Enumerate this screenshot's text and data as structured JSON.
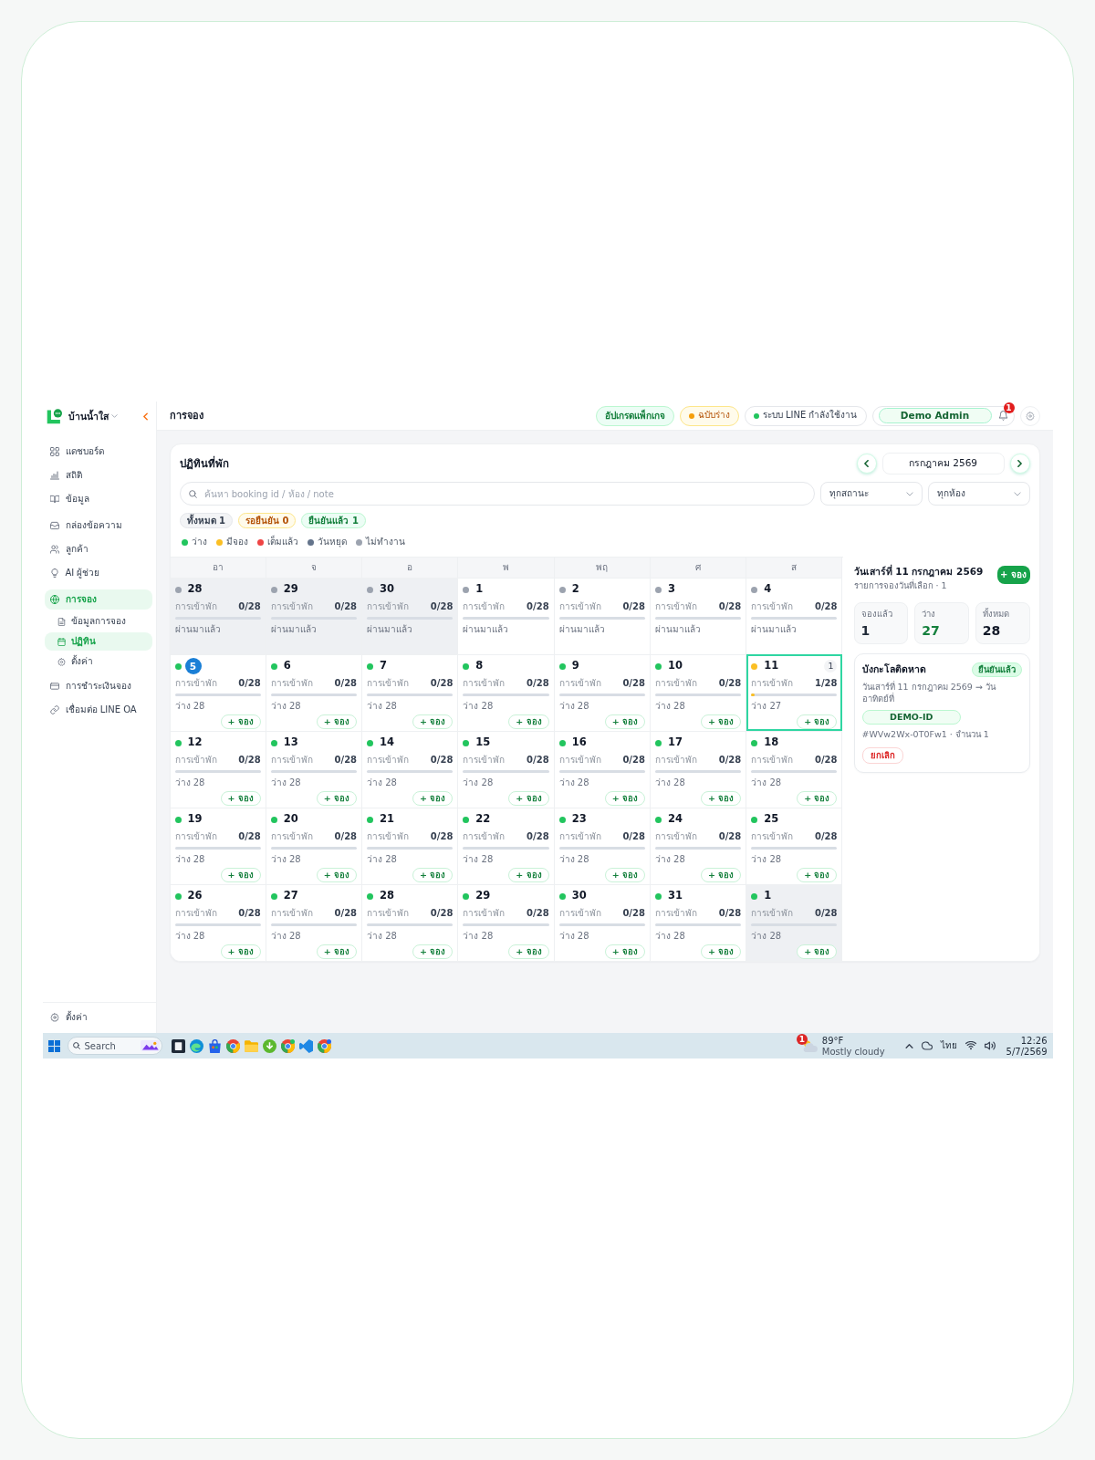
{
  "sidebar": {
    "brand": "บ้านน้ำใส",
    "sections": [
      {
        "items": [
          {
            "label": "แดชบอร์ด",
            "selected": false
          },
          {
            "label": "สถิติ",
            "selected": false
          },
          {
            "label": "ข้อมูล",
            "selected": false
          }
        ]
      },
      {
        "items": [
          {
            "label": "กล่องข้อความ",
            "selected": false
          },
          {
            "label": "ลูกค้า",
            "selected": false
          },
          {
            "label": "AI ผู้ช่วย",
            "selected": false
          }
        ]
      },
      {
        "items": [
          {
            "label": "การจอง",
            "selected": true,
            "children": [
              {
                "label": "ข้อมูลการจอง",
                "selected": false
              },
              {
                "label": "ปฏิทิน",
                "selected": true
              },
              {
                "label": "ตั้งค่า",
                "selected": false
              }
            ]
          }
        ]
      },
      {
        "items": [
          {
            "label": "การชำระเงินจอง",
            "selected": false
          },
          {
            "label": "เชื่อมต่อ LINE OA",
            "selected": false
          }
        ]
      }
    ],
    "footer_items": [
      {
        "label": "ตั้งค่า",
        "selected": false
      }
    ]
  },
  "header": {
    "title": "การจอง",
    "upgrade_button": "อัปเกรดแพ็กเกจ",
    "draft_badge": "ฉบับร่าง",
    "line_status": "ระบบ LINE กำลังใช้งาน",
    "user_name": "Demo Admin",
    "notification_count": "1"
  },
  "calendar": {
    "title": "ปฏิทินที่พัก",
    "month": "กรกฎาคม 2569",
    "search": {
      "placeholder": "ค้นหา booking id / ห้อง / note"
    },
    "filters": [
      {
        "value": "ทุกสถานะ"
      },
      {
        "value": "ทุกห้อง"
      }
    ],
    "chips": [
      {
        "label": "ทั้งหมด 1",
        "kind": "all"
      },
      {
        "label": "รอยืนยัน 0",
        "kind": "pending"
      },
      {
        "label": "ยืนยันแล้ว 1",
        "kind": "confirmed"
      }
    ],
    "legend": [
      {
        "label": "ว่าง",
        "color": "#22c55e"
      },
      {
        "label": "มีจอง",
        "color": "#fbbf24"
      },
      {
        "label": "เต็มแล้ว",
        "color": "#ef4444"
      },
      {
        "label": "วันหยุด",
        "color": "#64748b"
      },
      {
        "label": "ไม่ทำงาน",
        "color": "#9ca3af"
      }
    ],
    "weekdays": [
      "อา",
      "จ",
      "อ",
      "พ",
      "พฤ",
      "ศ",
      "ส"
    ],
    "weeks": [
      [
        {
          "day": "28",
          "color": "#9ca3af",
          "in_month": false,
          "today": false,
          "selected": false,
          "label": "การเข้าพัก",
          "occupancy": "0/28",
          "note": "ผ่านมาแล้ว"
        },
        {
          "day": "29",
          "color": "#9ca3af",
          "in_month": false,
          "today": false,
          "selected": false,
          "label": "การเข้าพัก",
          "occupancy": "0/28",
          "note": "ผ่านมาแล้ว"
        },
        {
          "day": "30",
          "color": "#9ca3af",
          "in_month": false,
          "today": false,
          "selected": false,
          "label": "การเข้าพัก",
          "occupancy": "0/28",
          "note": "ผ่านมาแล้ว"
        },
        {
          "day": "1",
          "color": "#9ca3af",
          "in_month": true,
          "today": false,
          "selected": false,
          "label": "การเข้าพัก",
          "occupancy": "0/28",
          "note": "ผ่านมาแล้ว"
        },
        {
          "day": "2",
          "color": "#9ca3af",
          "in_month": true,
          "today": false,
          "selected": false,
          "label": "การเข้าพัก",
          "occupancy": "0/28",
          "note": "ผ่านมาแล้ว"
        },
        {
          "day": "3",
          "color": "#9ca3af",
          "in_month": true,
          "today": false,
          "selected": false,
          "label": "การเข้าพัก",
          "occupancy": "0/28",
          "note": "ผ่านมาแล้ว"
        },
        {
          "day": "4",
          "color": "#9ca3af",
          "in_month": true,
          "today": false,
          "selected": false,
          "label": "การเข้าพัก",
          "occupancy": "0/28",
          "note": "ผ่านมาแล้ว"
        }
      ],
      [
        {
          "day": "5",
          "color": "#22c55e",
          "in_month": true,
          "today": true,
          "selected": false,
          "label": "การเข้าพัก",
          "occupancy": "0/28",
          "note": "ว่าง 28",
          "book_button": "+ จอง"
        },
        {
          "day": "6",
          "color": "#22c55e",
          "in_month": true,
          "today": false,
          "selected": false,
          "label": "การเข้าพัก",
          "occupancy": "0/28",
          "note": "ว่าง 28",
          "book_button": "+ จอง"
        },
        {
          "day": "7",
          "color": "#22c55e",
          "in_month": true,
          "today": false,
          "selected": false,
          "label": "การเข้าพัก",
          "occupancy": "0/28",
          "note": "ว่าง 28",
          "book_button": "+ จอง"
        },
        {
          "day": "8",
          "color": "#22c55e",
          "in_month": true,
          "today": false,
          "selected": false,
          "label": "การเข้าพัก",
          "occupancy": "0/28",
          "note": "ว่าง 28",
          "book_button": "+ จอง"
        },
        {
          "day": "9",
          "color": "#22c55e",
          "in_month": true,
          "today": false,
          "selected": false,
          "label": "การเข้าพัก",
          "occupancy": "0/28",
          "note": "ว่าง 28",
          "book_button": "+ จอง"
        },
        {
          "day": "10",
          "color": "#22c55e",
          "in_month": true,
          "today": false,
          "selected": false,
          "label": "การเข้าพัก",
          "occupancy": "0/28",
          "note": "ว่าง 28",
          "book_button": "+ จอง"
        },
        {
          "day": "11",
          "color": "#fbbf24",
          "in_month": true,
          "today": false,
          "selected": true,
          "count": "1",
          "label": "การเข้าพัก",
          "occupancy": "1/28",
          "level": 0.036,
          "note": "ว่าง 27",
          "book_button": "+ จอง"
        }
      ],
      [
        {
          "day": "12",
          "color": "#22c55e",
          "in_month": true,
          "today": false,
          "selected": false,
          "label": "การเข้าพัก",
          "occupancy": "0/28",
          "note": "ว่าง 28",
          "book_button": "+ จอง"
        },
        {
          "day": "13",
          "color": "#22c55e",
          "in_month": true,
          "today": false,
          "selected": false,
          "label": "การเข้าพัก",
          "occupancy": "0/28",
          "note": "ว่าง 28",
          "book_button": "+ จอง"
        },
        {
          "day": "14",
          "color": "#22c55e",
          "in_month": true,
          "today": false,
          "selected": false,
          "label": "การเข้าพัก",
          "occupancy": "0/28",
          "note": "ว่าง 28",
          "book_button": "+ จอง"
        },
        {
          "day": "15",
          "color": "#22c55e",
          "in_month": true,
          "today": false,
          "selected": false,
          "label": "การเข้าพัก",
          "occupancy": "0/28",
          "note": "ว่าง 28",
          "book_button": "+ จอง"
        },
        {
          "day": "16",
          "color": "#22c55e",
          "in_month": true,
          "today": false,
          "selected": false,
          "label": "การเข้าพัก",
          "occupancy": "0/28",
          "note": "ว่าง 28",
          "book_button": "+ จอง"
        },
        {
          "day": "17",
          "color": "#22c55e",
          "in_month": true,
          "today": false,
          "selected": false,
          "label": "การเข้าพัก",
          "occupancy": "0/28",
          "note": "ว่าง 28",
          "book_button": "+ จอง"
        },
        {
          "day": "18",
          "color": "#22c55e",
          "in_month": true,
          "today": false,
          "selected": false,
          "label": "การเข้าพัก",
          "occupancy": "0/28",
          "note": "ว่าง 28",
          "book_button": "+ จอง"
        }
      ],
      [
        {
          "day": "19",
          "color": "#22c55e",
          "in_month": true,
          "today": false,
          "selected": false,
          "label": "การเข้าพัก",
          "occupancy": "0/28",
          "note": "ว่าง 28",
          "book_button": "+ จอง"
        },
        {
          "day": "20",
          "color": "#22c55e",
          "in_month": true,
          "today": false,
          "selected": false,
          "label": "การเข้าพัก",
          "occupancy": "0/28",
          "note": "ว่าง 28",
          "book_button": "+ จอง"
        },
        {
          "day": "21",
          "color": "#22c55e",
          "in_month": true,
          "today": false,
          "selected": false,
          "label": "การเข้าพัก",
          "occupancy": "0/28",
          "note": "ว่าง 28",
          "book_button": "+ จอง"
        },
        {
          "day": "22",
          "color": "#22c55e",
          "in_month": true,
          "today": false,
          "selected": false,
          "label": "การเข้าพัก",
          "occupancy": "0/28",
          "note": "ว่าง 28",
          "book_button": "+ จอง"
        },
        {
          "day": "23",
          "color": "#22c55e",
          "in_month": true,
          "today": false,
          "selected": false,
          "label": "การเข้าพัก",
          "occupancy": "0/28",
          "note": "ว่าง 28",
          "book_button": "+ จอง"
        },
        {
          "day": "24",
          "color": "#22c55e",
          "in_month": true,
          "today": false,
          "selected": false,
          "label": "การเข้าพัก",
          "occupancy": "0/28",
          "note": "ว่าง 28",
          "book_button": "+ จอง"
        },
        {
          "day": "25",
          "color": "#22c55e",
          "in_month": true,
          "today": false,
          "selected": false,
          "label": "การเข้าพัก",
          "occupancy": "0/28",
          "note": "ว่าง 28",
          "book_button": "+ จอง"
        }
      ],
      [
        {
          "day": "26",
          "color": "#22c55e",
          "in_month": true,
          "today": false,
          "selected": false,
          "label": "การเข้าพัก",
          "occupancy": "0/28",
          "note": "ว่าง 28",
          "book_button": "+ จอง"
        },
        {
          "day": "27",
          "color": "#22c55e",
          "in_month": true,
          "today": false,
          "selected": false,
          "label": "การเข้าพัก",
          "occupancy": "0/28",
          "note": "ว่าง 28",
          "book_button": "+ จอง"
        },
        {
          "day": "28",
          "color": "#22c55e",
          "in_month": true,
          "today": false,
          "selected": false,
          "label": "การเข้าพัก",
          "occupancy": "0/28",
          "note": "ว่าง 28",
          "book_button": "+ จอง"
        },
        {
          "day": "29",
          "color": "#22c55e",
          "in_month": true,
          "today": false,
          "selected": false,
          "label": "การเข้าพัก",
          "occupancy": "0/28",
          "note": "ว่าง 28",
          "book_button": "+ จอง"
        },
        {
          "day": "30",
          "color": "#22c55e",
          "in_month": true,
          "today": false,
          "selected": false,
          "label": "การเข้าพัก",
          "occupancy": "0/28",
          "note": "ว่าง 28",
          "book_button": "+ จอง"
        },
        {
          "day": "31",
          "color": "#22c55e",
          "in_month": true,
          "today": false,
          "selected": false,
          "label": "การเข้าพัก",
          "occupancy": "0/28",
          "note": "ว่าง 28",
          "book_button": "+ จอง"
        },
        {
          "day": "1",
          "color": "#22c55e",
          "in_month": false,
          "today": false,
          "selected": false,
          "label": "การเข้าพัก",
          "occupancy": "0/28",
          "note": "ว่าง 28",
          "book_button": "+ จอง"
        }
      ]
    ]
  },
  "day_panel": {
    "title": "วันเสาร์ที่ 11 กรกฎาคม 2569",
    "subtitle": "รายการจองวันที่เลือก · 1",
    "add_button": "+ จอง",
    "stats": [
      {
        "label": "จองแล้ว",
        "value": "1",
        "kind": "booked"
      },
      {
        "label": "ว่าง",
        "value": "27",
        "kind": "available"
      },
      {
        "label": "ทั้งหมด",
        "value": "28",
        "kind": "total"
      }
    ],
    "bookings": [
      {
        "room": "บังกะโลติดหาด",
        "status": "ยืนยันแล้ว",
        "dates": "วันเสาร์ที่ 11 กรกฎาคม 2569 → วันอาทิตย์ที่",
        "tag": "DEMO-ID",
        "reference": "#WVw2Wx-0T0Fw1 · จำนวน 1",
        "cancel_button": "ยกเลิก"
      }
    ]
  },
  "taskbar": {
    "search": {
      "placeholder": "Search"
    },
    "weather": {
      "temperature": "89°F",
      "condition": "Mostly cloudy",
      "alert_count": "1"
    },
    "language": "ไทย",
    "time": "12:26",
    "date": "5/7/2569"
  }
}
